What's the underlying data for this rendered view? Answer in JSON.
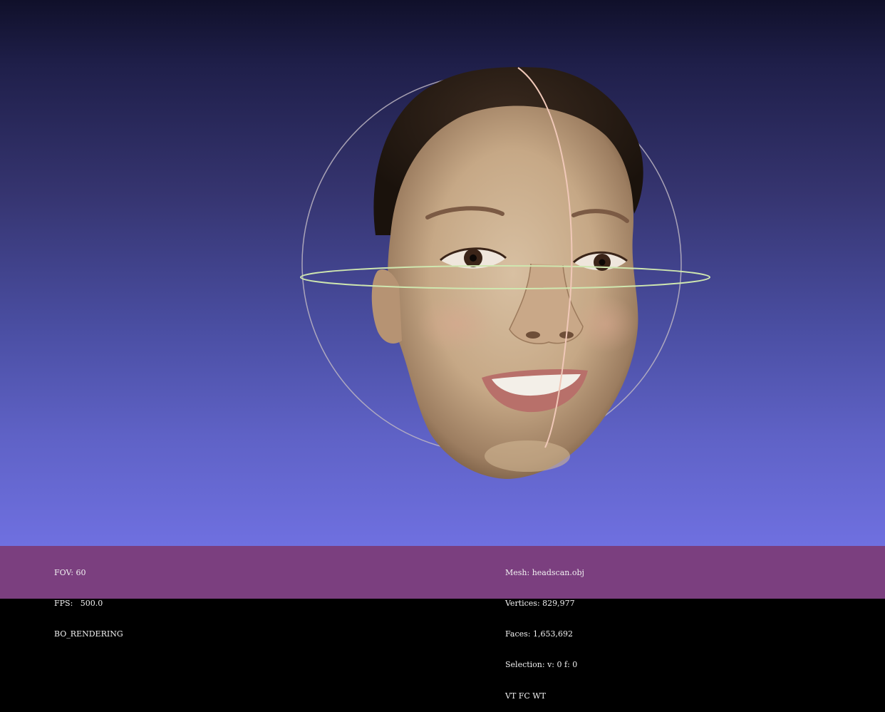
{
  "viewport": {
    "background_top": "#10102a",
    "background_bottom": "#6f70e0",
    "model": "scanned-head-mesh",
    "trackball_colors": {
      "sphere": "#bdb6c2",
      "horizontal_ring": "#cfe7b0",
      "vertical_ring": "#f0c8b8"
    }
  },
  "status_bar": {
    "color": "#7b3f7f",
    "left": {
      "fov": "FOV: 60",
      "fps": "FPS:   500.0",
      "mode": "BO_RENDERING"
    },
    "right": {
      "mesh": "Mesh: headscan.obj",
      "vertices": "Vertices: 829,977",
      "faces": "Faces: 1,653,692",
      "selection": "Selection: v: 0 f: 0",
      "flags": "VT FC WT"
    }
  }
}
